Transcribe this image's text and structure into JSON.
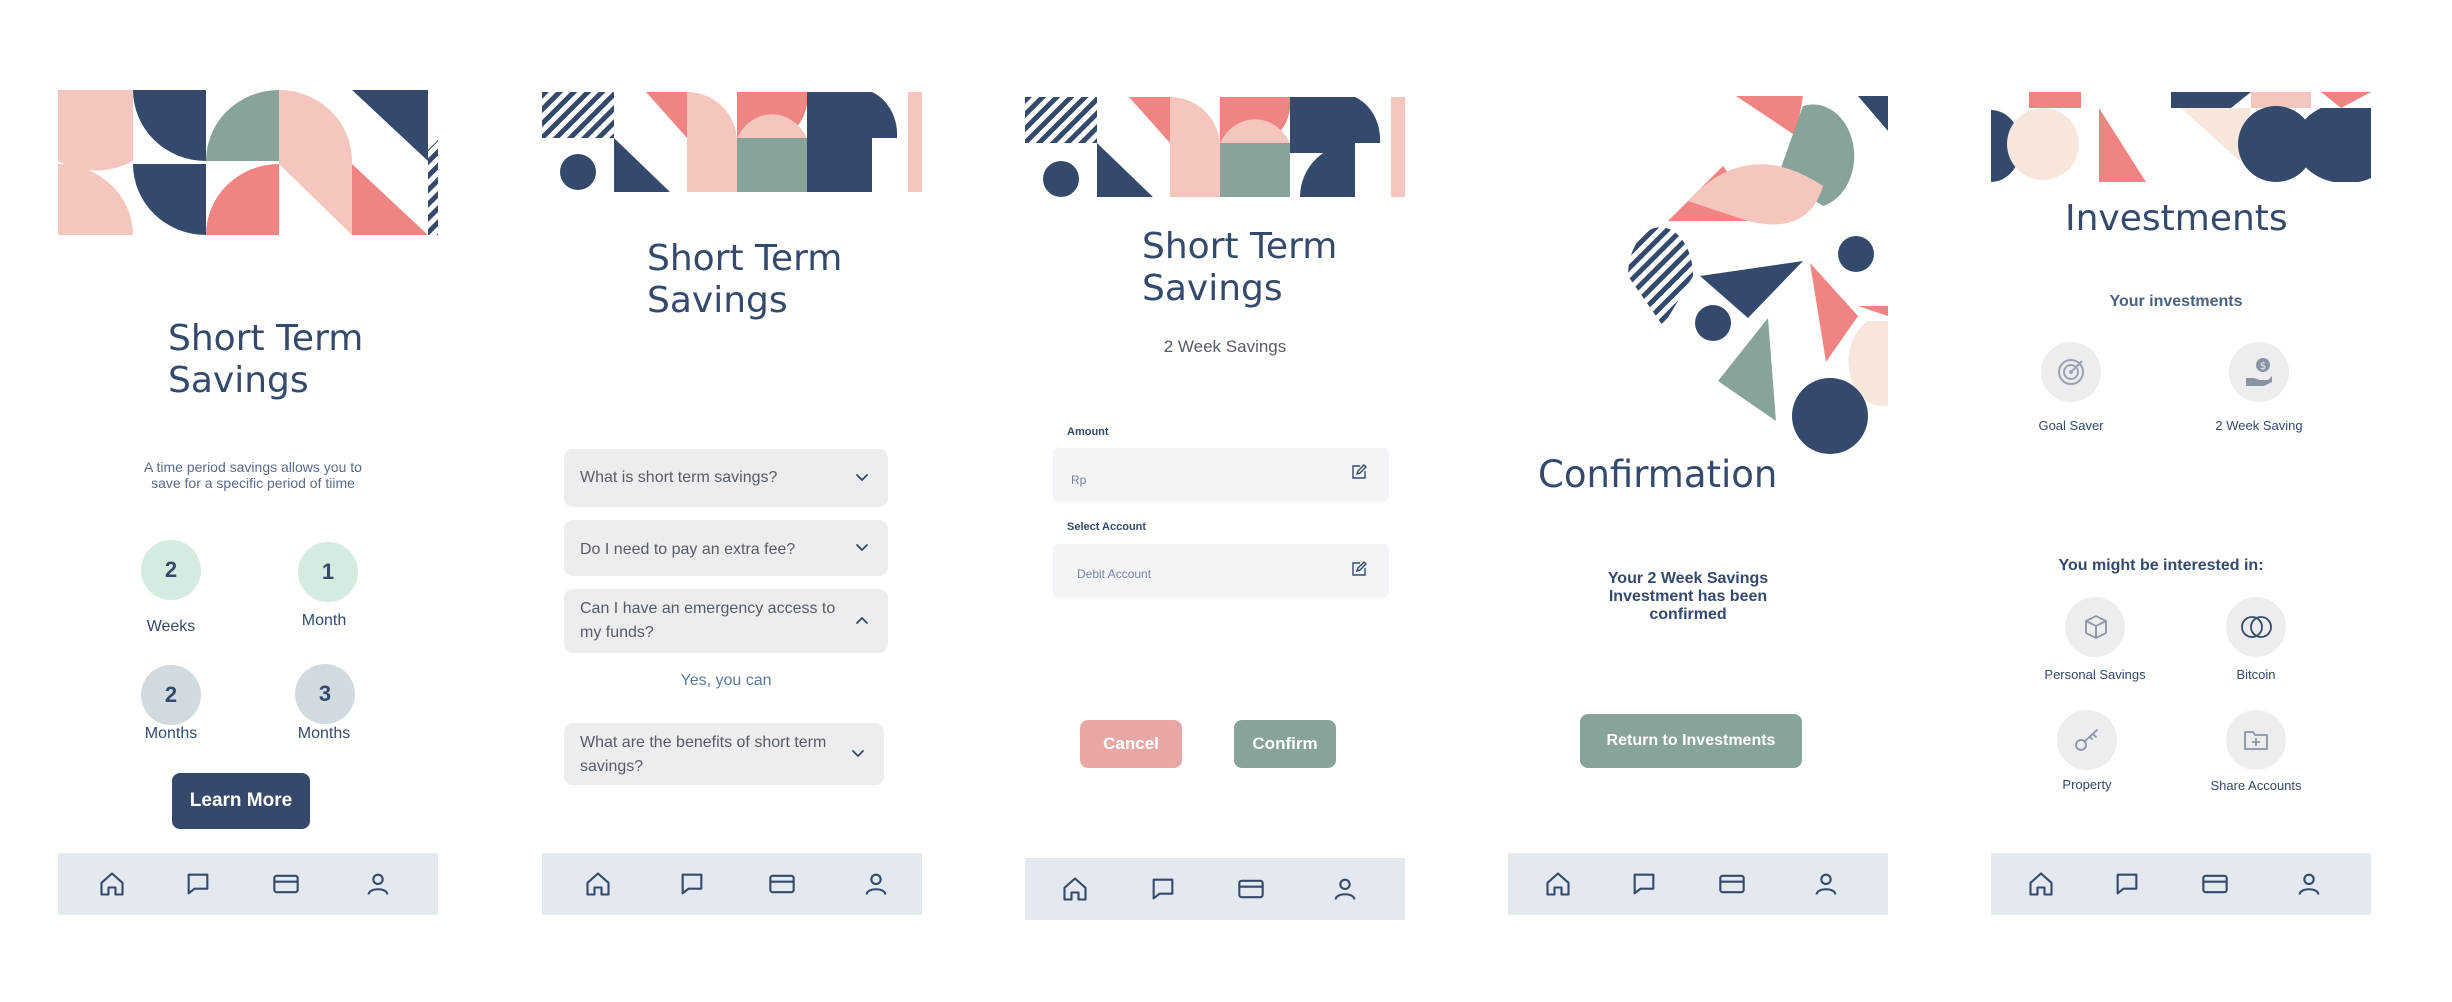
{
  "colors": {
    "navy": "#34496c",
    "pink": "#f5c6bd",
    "coral": "#f08482",
    "sage": "#87a39a",
    "cream": "#f7e6dc",
    "nav_bg": "#e4e8ef"
  },
  "screen1": {
    "title_line1": "Short Term",
    "title_line2": "Savings",
    "description": "A time period savings allows you to save for a specific period of tiime",
    "options": [
      {
        "number": "2",
        "label": "Weeks"
      },
      {
        "number": "1",
        "label": "Month"
      },
      {
        "number": "2",
        "label": "Months"
      },
      {
        "number": "3",
        "label": "Months"
      }
    ],
    "learn_more": "Learn More"
  },
  "screen2": {
    "title_line1": "Short Term",
    "title_line2": "Savings",
    "faqs": [
      {
        "question": "What is short term savings?",
        "expanded": false
      },
      {
        "question": "Do I need to pay an extra fee?",
        "expanded": false
      },
      {
        "question": "Can I have an emergency access to my funds?",
        "expanded": true,
        "answer": "Yes, you can"
      },
      {
        "question": "What are the benefits of short term savings?",
        "expanded": false
      }
    ]
  },
  "screen3": {
    "title_line1": "Short Term",
    "title_line2": "Savings",
    "subtitle": "2 Week Savings",
    "amount_label": "Amount",
    "amount_placeholder": "Rp",
    "account_label": "Select Account",
    "account_placeholder": "Debit Account",
    "cancel": "Cancel",
    "confirm": "Confirm"
  },
  "screen4": {
    "title": "Confirmation",
    "message": "Your 2 Week Savings Investment has been confirmed",
    "return_button": "Return to Investments"
  },
  "screen5": {
    "title": "Investments",
    "your_investments": "Your investments",
    "investments": [
      {
        "label": "Goal Saver",
        "icon": "target-icon"
      },
      {
        "label": "2 Week Saving",
        "icon": "hand-coin-icon"
      }
    ],
    "interested_heading": "You might be interested in:",
    "suggestions": [
      {
        "label": "Personal Savings",
        "icon": "box-icon"
      },
      {
        "label": "Bitcoin",
        "icon": "coins-icon"
      },
      {
        "label": "Property",
        "icon": "key-icon"
      },
      {
        "label": "Share Accounts",
        "icon": "folder-plus-icon"
      }
    ]
  },
  "nav_icons": [
    "home-icon",
    "chat-icon",
    "card-icon",
    "user-icon"
  ]
}
